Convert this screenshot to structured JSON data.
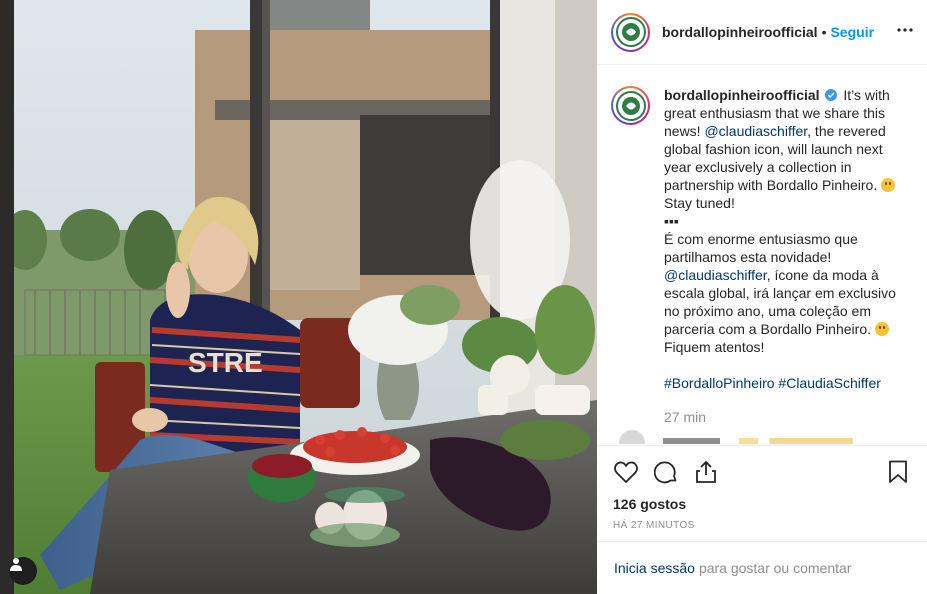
{
  "icons": {
    "user_tag": "user-icon",
    "more": "more-options-icon",
    "like": "heart-icon",
    "comment": "comment-icon",
    "share": "share-icon",
    "save": "bookmark-icon",
    "verified": "verified-badge-icon"
  },
  "colors": {
    "link": "#0095f6",
    "mention": "#00376b",
    "muted": "#8e8e8e"
  },
  "header": {
    "username": "bordallopinheiroofficial",
    "separator": "•",
    "follow_label": "Seguir"
  },
  "caption": {
    "username": "bordallopinheiroofficial",
    "en_1": " It’s with great enthusiasm that we share this news! ",
    "mention_1": "@claudiaschiffer",
    "en_2": ", the revered global fashion icon, will launch next year exclusively a collection in partnership with Bordallo Pinheiro. ",
    "en_3": " Stay tuned!",
    "dots": "▪▪▪",
    "pt_1": "É com enorme entusiasmo que partilhamos esta novidade! ",
    "mention_2": "@claudiaschiffer",
    "pt_2": ", ícone da moda à escala global, irá lançar em exclusivo no próximo ano, uma coleção em parceria com a Bordallo Pinheiro. ",
    "pt_3": " Fiquem atentos!",
    "hashtag_1": "#BordalloPinheiro",
    "hashtag_2": "#ClaudiaSchiffer",
    "time": "27 min"
  },
  "actions": {
    "likes": "126 gostos",
    "timestamp": "HÁ 27 MINUTOS"
  },
  "login": {
    "link": "Inicia sessão",
    "text": "para gostar ou comentar"
  }
}
